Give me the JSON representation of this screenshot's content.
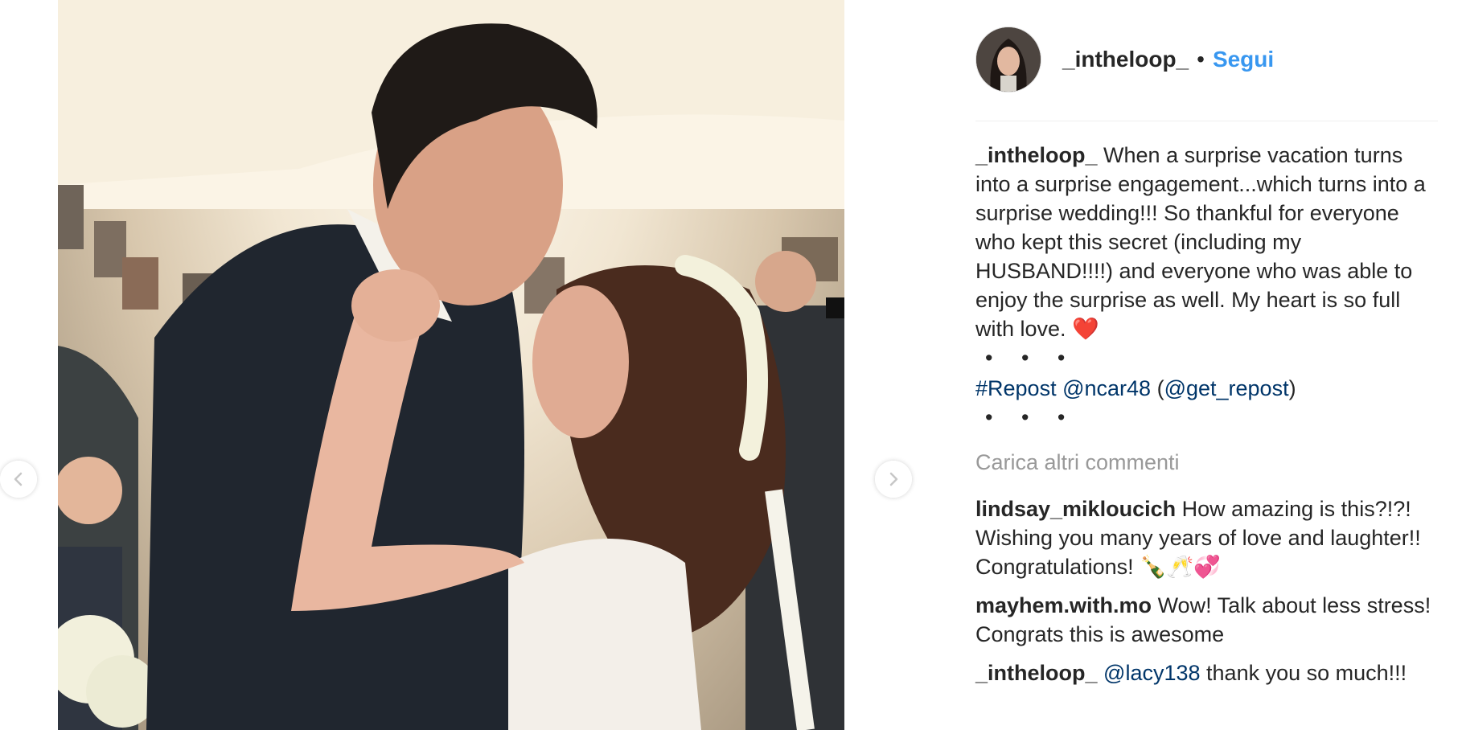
{
  "header": {
    "username": "_intheloop_",
    "separator": "•",
    "follow_label": "Segui"
  },
  "caption": {
    "username": "_intheloop_",
    "text": "When a surprise vacation turns into a surprise engagement...which turns into a surprise wedding!!! So thankful for everyone who kept this secret (including my HUSBAND!!!!) and everyone who was able to enjoy the surprise as well. My heart is so full with love.",
    "emoji": "❤️",
    "ellipsis_1": "• • •",
    "repost_tag": "#Repost",
    "repost_user": "@ncar48",
    "repost_source_open": "(",
    "repost_source": "@get_repost",
    "repost_source_close": ")",
    "ellipsis_2": "• • •"
  },
  "load_more_label": "Carica altri commenti",
  "comments": [
    {
      "username": "lindsay_mikloucich",
      "text": "How amazing is this?!?! Wishing you many years of love and laughter!! Congratulations!",
      "emoji": "🍾🥂💞"
    },
    {
      "username": "mayhem.with.mo",
      "text": "Wow! Talk about less stress! Congrats this is awesome"
    },
    {
      "username": "_intheloop_",
      "mention": "@lacy138",
      "text": "thank you so much!!!"
    }
  ],
  "icons": {
    "prev": "chevron-left-icon",
    "next": "chevron-right-icon"
  },
  "colors": {
    "link_blue": "#3897f0",
    "hashtag_navy": "#003569",
    "muted_gray": "#999999",
    "heart_red": "#ed1c24"
  }
}
